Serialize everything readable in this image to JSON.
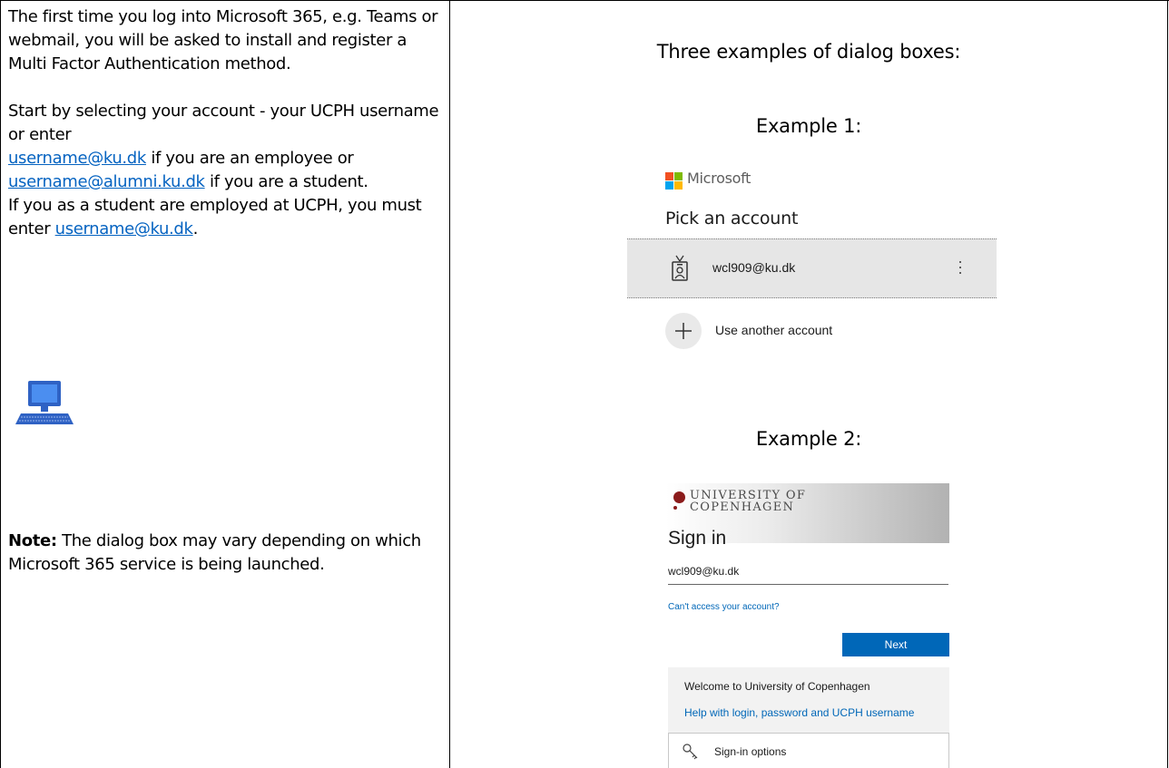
{
  "left": {
    "intro": "The first time you log into Microsoft 365, e.g. Teams or webmail, you will be asked to install and register a Multi Factor Authentication method.",
    "account_start": "Start by selecting your account - your UCPH username or enter",
    "link_employee": "username@ku.dk",
    "after_employee": " if you are an employee or ",
    "link_student": "username@alumni.ku.dk",
    "after_student": " if you are a student.",
    "employed_start": "If you as a student are employed at UCPH, you must enter ",
    "link_employed": "username@ku.dk",
    "employed_end": ".",
    "monitor_icon": "desktop-computer-icon",
    "note_label": "Note:",
    "note_text": " The dialog box may vary depending on which Microsoft 365 service is being launched."
  },
  "right": {
    "heading": "Three examples of dialog boxes:",
    "example1_label": "Example 1:",
    "example2_label": "Example 2:"
  },
  "example1": {
    "brand": "Microsoft",
    "title": "Pick an account",
    "account_email": "wcl909@ku.dk",
    "add_account": "Use another account",
    "logo_colors": [
      "#f25022",
      "#7fba00",
      "#00a4ef",
      "#ffb900"
    ]
  },
  "example2": {
    "university_line1": "UNIVERSITY OF",
    "university_line2": "COPENHAGEN",
    "title": "Sign in",
    "input_value": "wcl909@ku.dk",
    "cant_access": "Can't access your account?",
    "next_label": "Next",
    "welcome": "Welcome to University of Copenhagen",
    "help_link": "Help with login, password and UCPH username",
    "signin_options": "Sign-in options"
  },
  "colors": {
    "link": "#0563c1",
    "ms_blue": "#0067b8",
    "uni_red": "#8b1b1b"
  }
}
